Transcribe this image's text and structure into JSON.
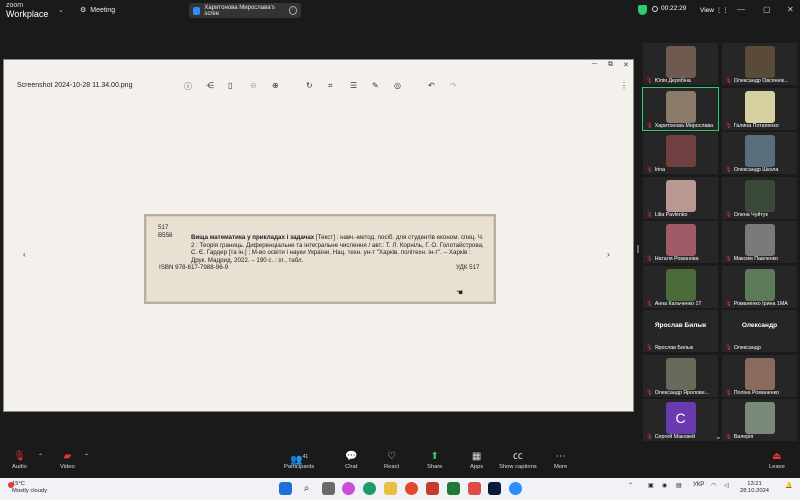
{
  "app": {
    "brand_line1": "zoom",
    "brand_line2": "Workplace",
    "meeting_label": "Meeting"
  },
  "share": {
    "title": "Харитонова Мирослава's scree"
  },
  "status": {
    "timer": "00:22:29",
    "view_label": "View"
  },
  "viewer": {
    "filename": "Screenshot 2024-10-28 11.34.00.png",
    "card": {
      "line1": "517",
      "line2": "В558",
      "title_bold": "Вища математика у прикладах і задачах",
      "body_rest": " [Текст] : навч.-метод. посіб. для студентів економ. спец. Ч. 2 : Теорія границь. Диференціальне та інтегральне числення / авт.: Т. Л. Корніль, Г. О. Голотайстрова, С. Є. Гардер [та ін.] ; М-во освіти і науки України, Нац. техн. ун-т \"Харків. політехн. ін-т\". – Харків : Друк. Мадрид, 2022. – 190 с. : іл., табл.",
      "isbn": "ISBN 978-617-7988-96-9",
      "udk": "УДК 517"
    }
  },
  "participants": [
    {
      "name": "Юлія Дерябіна",
      "bg": "#6e5a4e"
    },
    {
      "name": "Олександр Овсяннік...",
      "bg": "#5a4a3a"
    },
    {
      "name": "Харитонова Мирослава",
      "bg": "#8a7a6a"
    },
    {
      "name": "Галина Потапенко",
      "bg": "#d8d0a0"
    },
    {
      "name": "Irina",
      "bg": "#704040"
    },
    {
      "name": "Олександр Школа",
      "bg": "#5a6e7a"
    },
    {
      "name": "Lilia Pavlenko",
      "bg": "#b89890"
    },
    {
      "name": "Олена Чуйтук",
      "bg": "#3a4a3a"
    },
    {
      "name": "Наталя Романова",
      "bg": "#a05a6a"
    },
    {
      "name": "Максим Павленко",
      "bg": "#7a7a7a"
    },
    {
      "name": "Анна Кальченко 1Т",
      "bg": "#4a6a3a"
    },
    {
      "name": "Романенко Ірина 1МА",
      "bg": "#5a7a5a"
    },
    {
      "name": "Ярослав Билык",
      "big": "Ярослав Билык",
      "bg": "#262626"
    },
    {
      "name": "Олександр",
      "big": "Олександр",
      "bg": "#262626"
    },
    {
      "name": "Олександр Яроловe...",
      "bg": "#6a6a5a"
    },
    {
      "name": "Поліна Романенко",
      "bg": "#8a6a5a"
    },
    {
      "name": "Сергей Маковей",
      "bg": "#6a3ab0"
    },
    {
      "name": "Валерія",
      "bg": "#7a8a7a"
    }
  ],
  "avatar_letter": "C",
  "toolbar": {
    "audio": "Audio",
    "video": "Video",
    "participants": "Participants",
    "participants_count": "41",
    "chat": "Chat",
    "react": "React",
    "share": "Share",
    "apps": "Apps",
    "captions": "Show captions",
    "more": "More",
    "leave": "Leave"
  },
  "taskbar": {
    "weather_temp": "15°C",
    "weather_desc": "Mostly cloudy",
    "lang": "УКР",
    "time": "13:21",
    "date": "28.10.2024"
  },
  "colors": {
    "accent": "#2d8cff",
    "secure": "#2ecc71",
    "leave": "#e33"
  }
}
